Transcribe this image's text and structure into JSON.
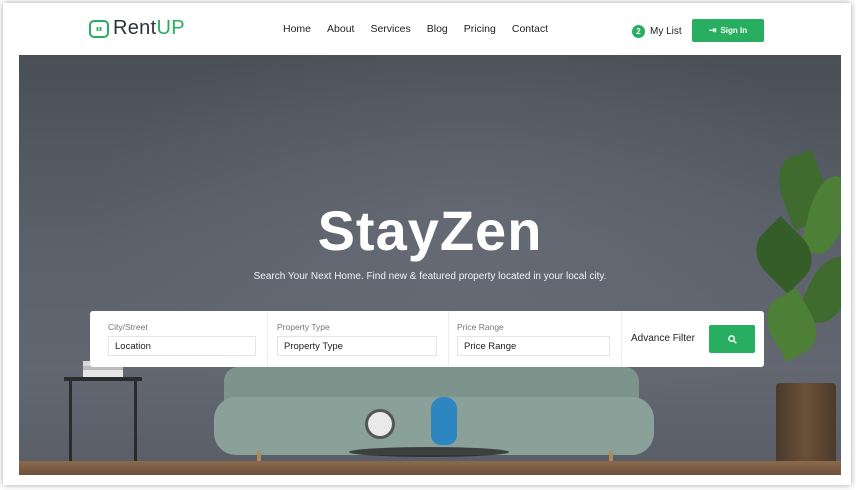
{
  "brand": {
    "name_part1": "Rent",
    "name_part2": "UP",
    "accent": "#27ae60"
  },
  "nav": {
    "items": [
      "Home",
      "About",
      "Services",
      "Blog",
      "Pricing",
      "Contact"
    ]
  },
  "mylist": {
    "count": "2",
    "label": "My List"
  },
  "signin": {
    "label": "Sign In",
    "icon": "sign-in-icon"
  },
  "hero": {
    "title": "StayZen",
    "subtitle": "Search Your Next Home. Find new & featured property located in your local city."
  },
  "search": {
    "city": {
      "label": "City/Street",
      "value": "Location"
    },
    "type": {
      "label": "Property Type",
      "value": "Property Type"
    },
    "price": {
      "label": "Price Range",
      "value": "Price Range"
    },
    "advance_label": "Advance Filter",
    "button_icon": "search-icon"
  }
}
